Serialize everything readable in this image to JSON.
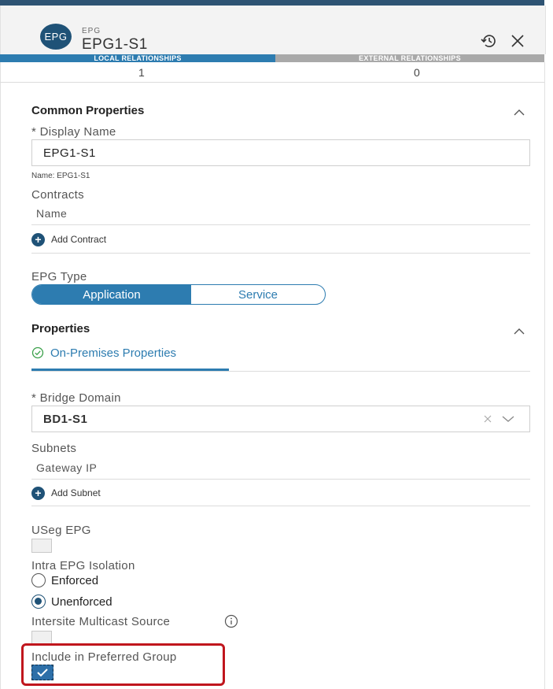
{
  "header": {
    "badge": "EPG",
    "kind_label": "EPG",
    "title": "EPG1-S1",
    "history_icon": "history-icon",
    "close_icon": "close-icon"
  },
  "tabs": [
    {
      "label": "LOCAL RELATIONSHIPS",
      "count": "1",
      "active": true
    },
    {
      "label": "EXTERNAL RELATIONSHIPS",
      "count": "0",
      "active": false
    }
  ],
  "common": {
    "title": "Common Properties",
    "display_name_label": "* Display Name",
    "display_name_value": "EPG1-S1",
    "name_hint": "Name: EPG1-S1",
    "contracts_label": "Contracts",
    "contracts_column": "Name",
    "add_contract": "Add Contract"
  },
  "epg_type": {
    "label": "EPG Type",
    "options": [
      "Application",
      "Service"
    ],
    "selected": "Application"
  },
  "properties": {
    "title": "Properties",
    "tab_label": "On-Premises Properties",
    "bridge_domain_label": "* Bridge Domain",
    "bridge_domain_value": "BD1-S1",
    "subnets_label": "Subnets",
    "subnets_column": "Gateway IP",
    "add_subnet": "Add Subnet",
    "useg_label": "USeg EPG",
    "useg_checked": false,
    "isolation_label": "Intra EPG Isolation",
    "isolation_options": [
      "Enforced",
      "Unenforced"
    ],
    "isolation_selected": "Unenforced",
    "multicast_label": "Intersite Multicast Source",
    "multicast_checked": false,
    "preferred_label": "Include in Preferred Group",
    "preferred_checked": true
  },
  "colors": {
    "accent": "#2d7cb0",
    "badge": "#1f5277",
    "highlight": "#c0161d"
  }
}
